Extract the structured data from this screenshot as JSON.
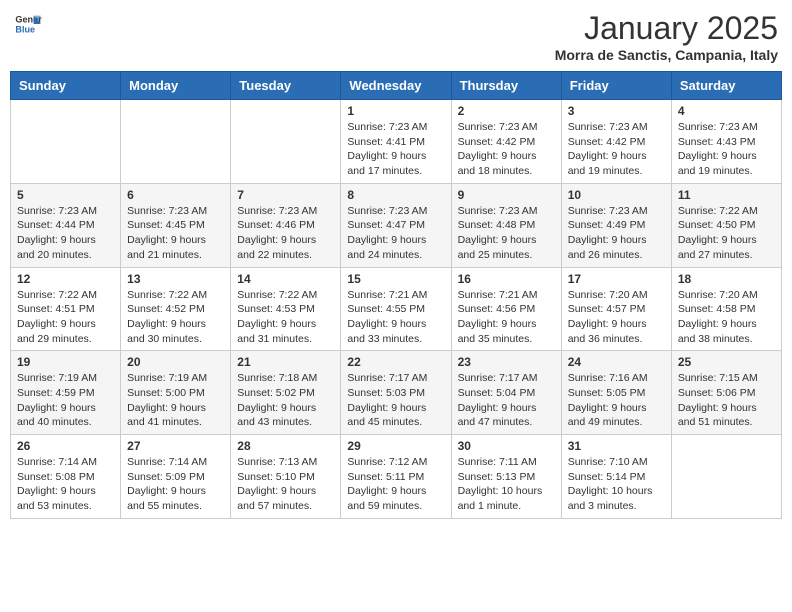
{
  "header": {
    "logo_general": "General",
    "logo_blue": "Blue",
    "month": "January 2025",
    "location": "Morra de Sanctis, Campania, Italy"
  },
  "weekdays": [
    "Sunday",
    "Monday",
    "Tuesday",
    "Wednesday",
    "Thursday",
    "Friday",
    "Saturday"
  ],
  "weeks": [
    [
      {
        "day": "",
        "info": ""
      },
      {
        "day": "",
        "info": ""
      },
      {
        "day": "",
        "info": ""
      },
      {
        "day": "1",
        "info": "Sunrise: 7:23 AM\nSunset: 4:41 PM\nDaylight: 9 hours\nand 17 minutes."
      },
      {
        "day": "2",
        "info": "Sunrise: 7:23 AM\nSunset: 4:42 PM\nDaylight: 9 hours\nand 18 minutes."
      },
      {
        "day": "3",
        "info": "Sunrise: 7:23 AM\nSunset: 4:42 PM\nDaylight: 9 hours\nand 19 minutes."
      },
      {
        "day": "4",
        "info": "Sunrise: 7:23 AM\nSunset: 4:43 PM\nDaylight: 9 hours\nand 19 minutes."
      }
    ],
    [
      {
        "day": "5",
        "info": "Sunrise: 7:23 AM\nSunset: 4:44 PM\nDaylight: 9 hours\nand 20 minutes."
      },
      {
        "day": "6",
        "info": "Sunrise: 7:23 AM\nSunset: 4:45 PM\nDaylight: 9 hours\nand 21 minutes."
      },
      {
        "day": "7",
        "info": "Sunrise: 7:23 AM\nSunset: 4:46 PM\nDaylight: 9 hours\nand 22 minutes."
      },
      {
        "day": "8",
        "info": "Sunrise: 7:23 AM\nSunset: 4:47 PM\nDaylight: 9 hours\nand 24 minutes."
      },
      {
        "day": "9",
        "info": "Sunrise: 7:23 AM\nSunset: 4:48 PM\nDaylight: 9 hours\nand 25 minutes."
      },
      {
        "day": "10",
        "info": "Sunrise: 7:23 AM\nSunset: 4:49 PM\nDaylight: 9 hours\nand 26 minutes."
      },
      {
        "day": "11",
        "info": "Sunrise: 7:22 AM\nSunset: 4:50 PM\nDaylight: 9 hours\nand 27 minutes."
      }
    ],
    [
      {
        "day": "12",
        "info": "Sunrise: 7:22 AM\nSunset: 4:51 PM\nDaylight: 9 hours\nand 29 minutes."
      },
      {
        "day": "13",
        "info": "Sunrise: 7:22 AM\nSunset: 4:52 PM\nDaylight: 9 hours\nand 30 minutes."
      },
      {
        "day": "14",
        "info": "Sunrise: 7:22 AM\nSunset: 4:53 PM\nDaylight: 9 hours\nand 31 minutes."
      },
      {
        "day": "15",
        "info": "Sunrise: 7:21 AM\nSunset: 4:55 PM\nDaylight: 9 hours\nand 33 minutes."
      },
      {
        "day": "16",
        "info": "Sunrise: 7:21 AM\nSunset: 4:56 PM\nDaylight: 9 hours\nand 35 minutes."
      },
      {
        "day": "17",
        "info": "Sunrise: 7:20 AM\nSunset: 4:57 PM\nDaylight: 9 hours\nand 36 minutes."
      },
      {
        "day": "18",
        "info": "Sunrise: 7:20 AM\nSunset: 4:58 PM\nDaylight: 9 hours\nand 38 minutes."
      }
    ],
    [
      {
        "day": "19",
        "info": "Sunrise: 7:19 AM\nSunset: 4:59 PM\nDaylight: 9 hours\nand 40 minutes."
      },
      {
        "day": "20",
        "info": "Sunrise: 7:19 AM\nSunset: 5:00 PM\nDaylight: 9 hours\nand 41 minutes."
      },
      {
        "day": "21",
        "info": "Sunrise: 7:18 AM\nSunset: 5:02 PM\nDaylight: 9 hours\nand 43 minutes."
      },
      {
        "day": "22",
        "info": "Sunrise: 7:17 AM\nSunset: 5:03 PM\nDaylight: 9 hours\nand 45 minutes."
      },
      {
        "day": "23",
        "info": "Sunrise: 7:17 AM\nSunset: 5:04 PM\nDaylight: 9 hours\nand 47 minutes."
      },
      {
        "day": "24",
        "info": "Sunrise: 7:16 AM\nSunset: 5:05 PM\nDaylight: 9 hours\nand 49 minutes."
      },
      {
        "day": "25",
        "info": "Sunrise: 7:15 AM\nSunset: 5:06 PM\nDaylight: 9 hours\nand 51 minutes."
      }
    ],
    [
      {
        "day": "26",
        "info": "Sunrise: 7:14 AM\nSunset: 5:08 PM\nDaylight: 9 hours\nand 53 minutes."
      },
      {
        "day": "27",
        "info": "Sunrise: 7:14 AM\nSunset: 5:09 PM\nDaylight: 9 hours\nand 55 minutes."
      },
      {
        "day": "28",
        "info": "Sunrise: 7:13 AM\nSunset: 5:10 PM\nDaylight: 9 hours\nand 57 minutes."
      },
      {
        "day": "29",
        "info": "Sunrise: 7:12 AM\nSunset: 5:11 PM\nDaylight: 9 hours\nand 59 minutes."
      },
      {
        "day": "30",
        "info": "Sunrise: 7:11 AM\nSunset: 5:13 PM\nDaylight: 10 hours\nand 1 minute."
      },
      {
        "day": "31",
        "info": "Sunrise: 7:10 AM\nSunset: 5:14 PM\nDaylight: 10 hours\nand 3 minutes."
      },
      {
        "day": "",
        "info": ""
      }
    ]
  ]
}
